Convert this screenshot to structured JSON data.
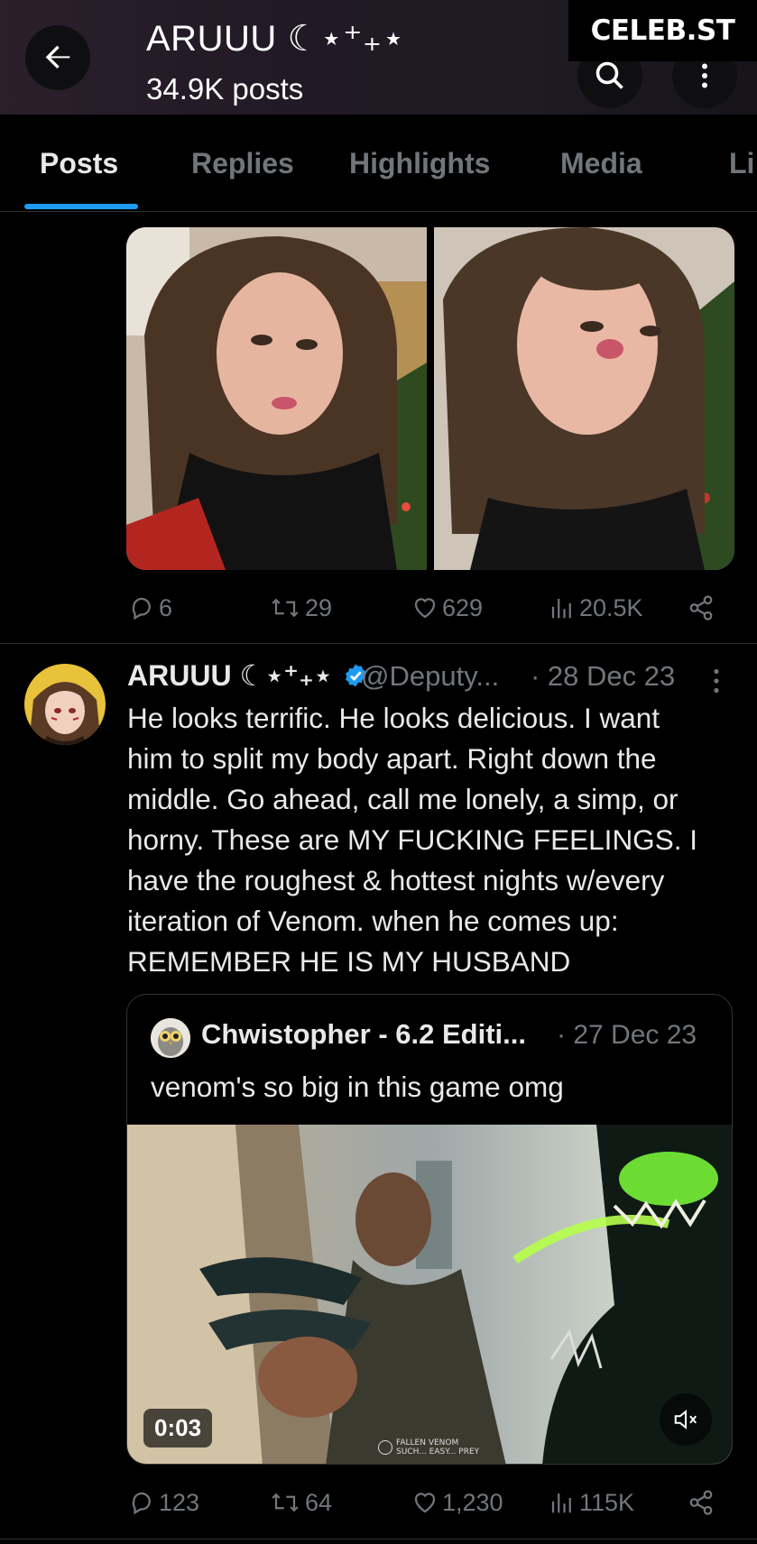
{
  "header": {
    "title": "ARUUU ☾⋆⁺₊⋆",
    "post_count": "34.9K posts",
    "back_icon": "arrow-left-icon",
    "search_icon": "search-icon",
    "more_icon": "more-vertical-icon"
  },
  "watermark": "CELEB.ST",
  "tabs": [
    {
      "label": "Posts",
      "active": true
    },
    {
      "label": "Replies",
      "active": false
    },
    {
      "label": "Highlights",
      "active": false
    },
    {
      "label": "Media",
      "active": false
    },
    {
      "label": "Li",
      "active": false
    }
  ],
  "post1": {
    "actions": {
      "replies": "6",
      "reposts": "29",
      "likes": "629",
      "views": "20.5K"
    }
  },
  "tweet": {
    "name": "ARUUU ☾⋆⁺₊⋆",
    "verified": true,
    "handle": "@Deputy...",
    "date": "· 28 Dec 23",
    "body": "He looks terrific. He looks delicious. I want\nhim to split my body apart. Right down the\nmiddle. Go ahead, call me lonely, a simp, or\nhorny. These are MY FUCKING FEELINGS. I\nhave the roughest & hottest nights w/every\niteration of Venom. when he comes up:\nREMEMBER HE IS MY HUSBAND",
    "quote": {
      "name": "Chwistopher - 6.2 Editi...",
      "date": "· 27 Dec 23",
      "text": "venom's so big in this game omg",
      "video_duration": "0:03",
      "video_caption_line1": "FALLEN VENOM",
      "video_caption_line2": "SUCH... EASY... PREY"
    },
    "actions": {
      "replies": "123",
      "reposts": "64",
      "likes": "1,230",
      "views": "115K"
    }
  },
  "colors": {
    "background": "#000000",
    "text": "#e7e9ea",
    "muted": "#71767b",
    "accent": "#1d9bf0",
    "divider": "#2f3336"
  }
}
